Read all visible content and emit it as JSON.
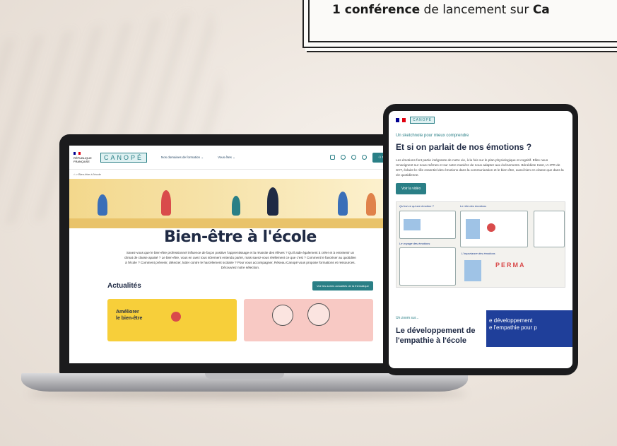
{
  "banner": {
    "bold_count": "1 conférence",
    "text": " de lancement sur ",
    "bold_cut": "Ca"
  },
  "laptop_site": {
    "republic_line1": "RÉPUBLIQUE",
    "republic_line2": "FRANÇAISE",
    "logo": "CANOPÉ",
    "nav": [
      "Nos domaines de formation",
      "Vous êtes"
    ],
    "connect_button": "Me connecter",
    "breadcrumb": "⌂ > Bien-être à l'école",
    "hero_title": "Bien-être à l'école",
    "hero_description": "Savez-vous que le bien-être professionnel influence de façon positive l'apprentissage et la réussite des élèves ? Qu'il aide également à créer et à entretenir un climat de classe apaisé ? Le bien-être, vous en avez tous sûrement entendu parler, mais savez-vous réellement ce que c'est ? Comment le favoriser au quotidien à l'école ? Comment prévenir, détecter, lutter contre le harcèlement scolaire ? Pour vous accompagner, Réseau Canopé vous propose formations et ressources. Découvrez notre sélection.",
    "news_title": "Actualités",
    "news_button": "Voir les autres actualités de la thématique",
    "card1_label_l1": "Améliorer",
    "card1_label_l2": "le bien-être"
  },
  "tablet_site": {
    "logo": "CANOPÉ",
    "kicker": "Un sketchnote pour mieux comprendre",
    "title": "Et si on parlait de nos émotions ?",
    "text": "Les émotions font partie intégrante de notre vie, à la fois sur le plan physiologique et cognitif. Elles nous renseignent sur nous-mêmes et sur notre manière de nous adapter aux événements. Bénédicte Hant, IA-IPR de SVT, éclaire le rôle essentiel des émotions dans la communication et le bien-être, aussi bien en classe que dans la vie quotidienne.",
    "video_button": "Voir la vidéo",
    "sketch_labels": [
      "Qu'est-ce qu'une émotion ?",
      "Le rôle des émotions",
      "Le voyage des émotions",
      "L'importance des émotions",
      "PERMA"
    ],
    "zoom_kicker": "Un zoom sur...",
    "zoom_title": "Le développement de l'empathie à l'école",
    "zoom_image_text_l1": "e développement",
    "zoom_image_text_l2": "e l'empathie pour p"
  },
  "colors": {
    "canope_teal": "#2a7f86",
    "navy": "#1f2a44",
    "card_yellow": "#f7cf3a",
    "card_pink": "#f8c9c4",
    "zoom_blue": "#1f3f9a"
  }
}
